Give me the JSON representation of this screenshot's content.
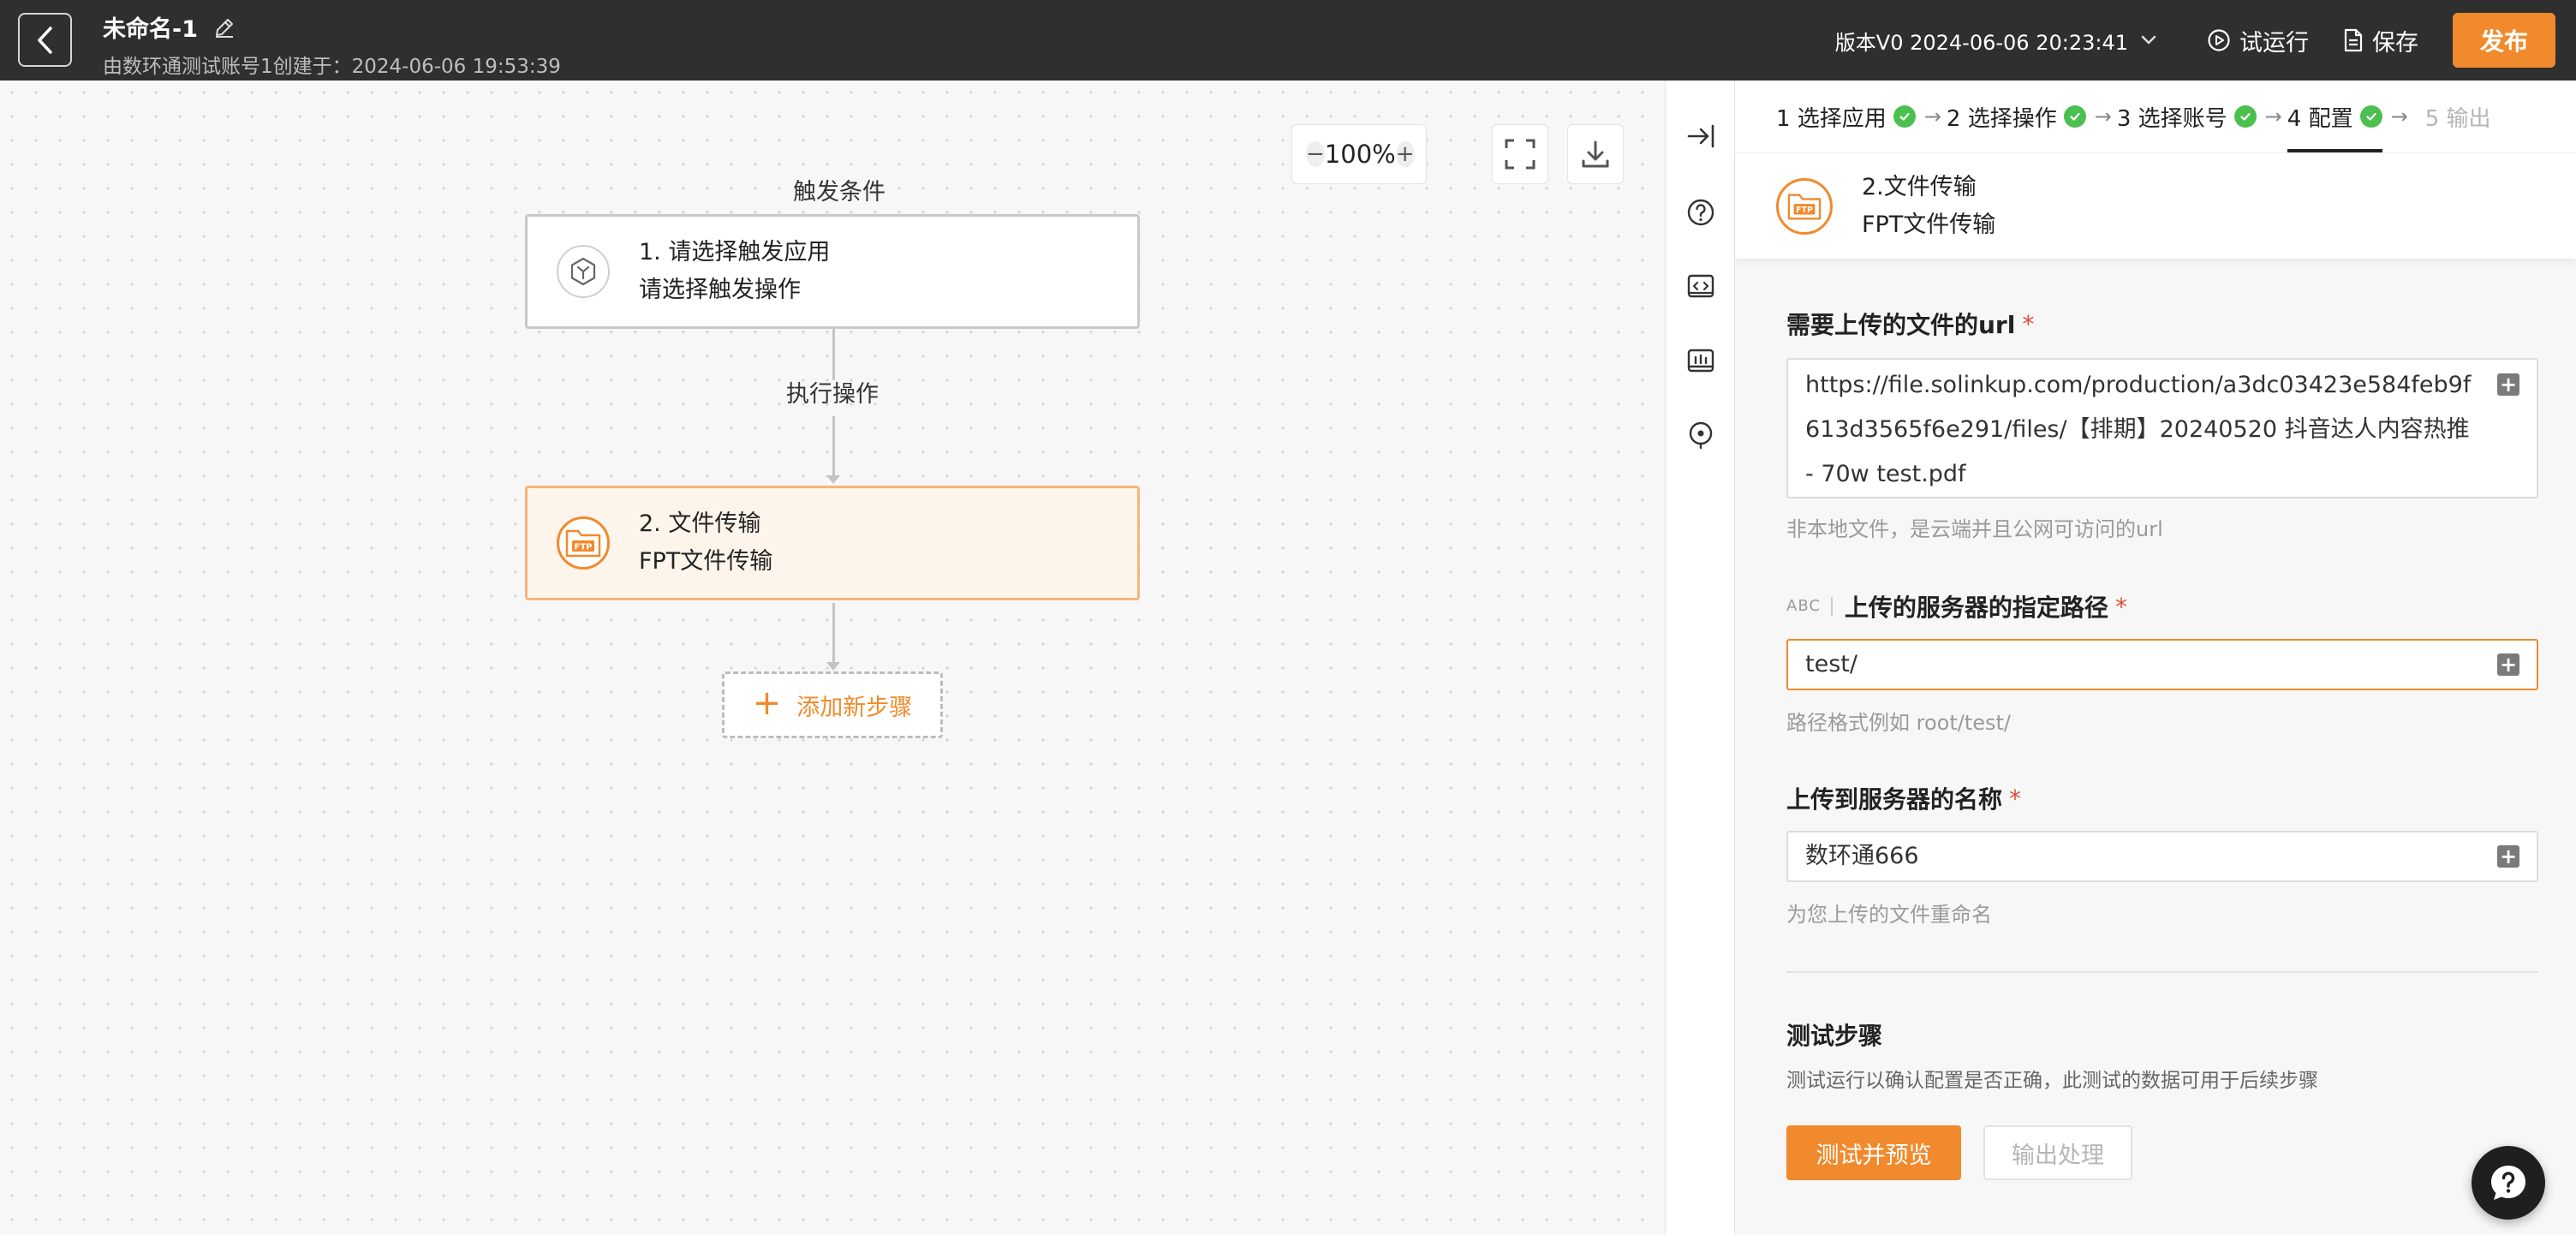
{
  "header": {
    "title": "未命名-1",
    "subtitle": "由数环通测试账号1创建于：2024-06-06 19:53:39",
    "version": "版本V0 2024-06-06 20:23:41",
    "test_run": "试运行",
    "save": "保存",
    "publish": "发布"
  },
  "canvas": {
    "zoom": "100%",
    "zoom_minus": "−",
    "zoom_plus": "+",
    "trigger_label": "触发条件",
    "trigger_node": {
      "title": "1. 请选择触发应用",
      "subtitle": "请选择触发操作"
    },
    "action_label": "执行操作",
    "action_node": {
      "title": "2. 文件传输",
      "subtitle": "FPT文件传输"
    },
    "add_step": "添加新步骤",
    "add_step_icon": "+"
  },
  "panel": {
    "steps": [
      {
        "label": "1 选择应用",
        "done": true
      },
      {
        "label": "2 选择操作",
        "done": true
      },
      {
        "label": "3 选择账号",
        "done": true
      },
      {
        "label": "4 配置",
        "done": true
      },
      {
        "label": "5 输出",
        "done": false
      }
    ],
    "step_separator": "→",
    "app": {
      "name": "2.文件传输",
      "desc": "FPT文件传输"
    },
    "fields": [
      {
        "label": "需要上传的文件的url",
        "required": "*",
        "value": "https://file.solinkup.com/production/a3dc03423e584feb9f613d3565f6e291/files/【排期】20240520 抖音达人内容热推 - 70w test.pdf",
        "help": "非本地文件，是云端并且公网可访问的url"
      },
      {
        "tag": "ABC",
        "label": "上传的服务器的指定路径",
        "required": "*",
        "value": "test/",
        "help": "路径格式例如 root/test/"
      },
      {
        "label": "上传到服务器的名称",
        "required": "*",
        "value": "数环通666",
        "help": "为您上传的文件重命名"
      }
    ],
    "insert_icon": "+",
    "test": {
      "title": "测试步骤",
      "desc": "测试运行以确认配置是否正确，此测试的数据可用于后续步骤",
      "primary_btn": "测试并预览",
      "secondary_btn": "输出处理"
    }
  },
  "colors": {
    "accent": "#f08a2c",
    "topbar": "#2f2f2f",
    "success": "#4cc04f",
    "required": "#e14b3b"
  }
}
